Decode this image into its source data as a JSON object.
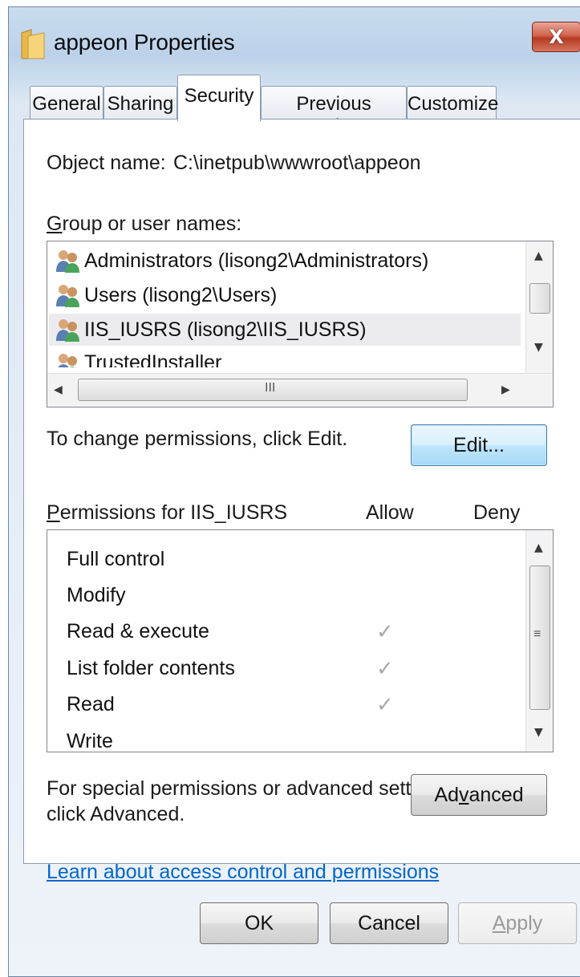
{
  "window": {
    "title": "appeon Properties",
    "close_glyph": "X",
    "icon": "folder-icon"
  },
  "tabs": [
    {
      "label": "General",
      "active": false
    },
    {
      "label": "Sharing",
      "active": false
    },
    {
      "label": "Security",
      "active": true
    },
    {
      "label": "Previous Versions",
      "active": false
    },
    {
      "label": "Customize",
      "active": false
    }
  ],
  "security": {
    "object_name_label": "Object name:",
    "object_name_value": "C:\\inetpub\\wwwroot\\appeon",
    "group_label_first": "G",
    "group_label_rest": "roup or user names:",
    "users": [
      {
        "name": "Administrators (lisong2\\Administrators)",
        "icon": "user-group-icon",
        "selected": false
      },
      {
        "name": "Users (lisong2\\Users)",
        "icon": "user-group-icon",
        "selected": false
      },
      {
        "name": "IIS_IUSRS (lisong2\\IIS_IUSRS)",
        "icon": "user-group-icon",
        "selected": true
      },
      {
        "name": "TrustedInstaller",
        "icon": "user-group-icon",
        "selected": false
      }
    ],
    "change_hint": "To change permissions, click Edit.",
    "edit_button": "Edit...",
    "perm_label_first": "P",
    "perm_label_rest": "ermissions for IIS_IUSRS",
    "allow_header": "Allow",
    "deny_header": "Deny",
    "permissions": [
      {
        "name": "Full control",
        "allow": false,
        "deny": false
      },
      {
        "name": "Modify",
        "allow": false,
        "deny": false
      },
      {
        "name": "Read & execute",
        "allow": true,
        "deny": false
      },
      {
        "name": "List folder contents",
        "allow": true,
        "deny": false
      },
      {
        "name": "Read",
        "allow": true,
        "deny": false
      },
      {
        "name": "Write",
        "allow": false,
        "deny": false
      }
    ],
    "check_glyph": "✓",
    "advanced_hint_line1": "For special permissions or advanced settings,",
    "advanced_hint_line2": "click Advanced.",
    "advanced_button_a": "Ad",
    "advanced_button_v": "v",
    "advanced_button_rest": "anced",
    "learn_link": "Learn about access control and permissions"
  },
  "footer": {
    "ok": "OK",
    "cancel": "Cancel",
    "apply_first": "A",
    "apply_rest": "pply"
  },
  "scroll": {
    "up": "▲",
    "down": "▼",
    "left": "◀",
    "right": "▶",
    "h_grip": "III",
    "v_grip": "≡"
  },
  "colors": {
    "link": "#0066cc",
    "close_button": "#c4452c",
    "default_button_border": "#3c7fb1"
  }
}
